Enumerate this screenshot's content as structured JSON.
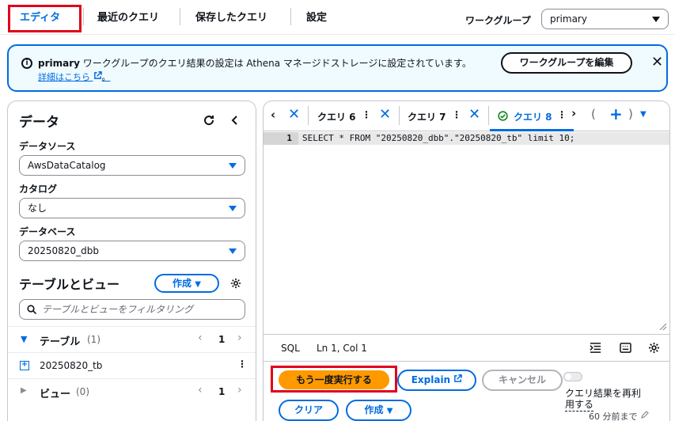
{
  "top_tabs": [
    {
      "label": "エディタ"
    },
    {
      "label": "最近のクエリ"
    },
    {
      "label": "保存したクエリ"
    },
    {
      "label": "設定"
    }
  ],
  "workgroup": {
    "label": "ワークグループ",
    "value": "primary"
  },
  "banner": {
    "workgroup_name": "primary",
    "text": " ワークグループのクエリ結果の設定は Athena マネージドストレージに設定されています。",
    "link": "詳細はこちら",
    "edit_button": "ワークグループを編集"
  },
  "data_panel": {
    "title": "データ",
    "data_source_label": "データソース",
    "data_source_value": "AwsDataCatalog",
    "catalog_label": "カタログ",
    "catalog_value": "なし",
    "database_label": "データベース",
    "database_value": "20250820_dbb",
    "tables_views_title": "テーブルとビュー",
    "create_button": "作成",
    "filter_placeholder": "テーブルとビューをフィルタリング",
    "tables": {
      "label": "テーブル",
      "count": "(1)",
      "page": "1",
      "items": [
        "20250820_tb"
      ]
    },
    "views": {
      "label": "ビュー",
      "count": "(0)",
      "page": "1"
    }
  },
  "editor": {
    "tabs": [
      {
        "label": "クエリ 6"
      },
      {
        "label": "クエリ 7"
      },
      {
        "label": "クエリ 8"
      }
    ],
    "line_number": "1",
    "code": "SELECT * FROM \"20250820_dbb\".\"20250820_tb\" limit 10;",
    "status": {
      "lang": "SQL",
      "position": "Ln 1, Col 1"
    }
  },
  "actions": {
    "run_again": "もう一度実行する",
    "explain": "Explain",
    "cancel": "キャンセル",
    "reuse_label_1": "クエリ結果を再利",
    "reuse_label_2": "用する",
    "reuse_age": "60 分前まで",
    "clear": "クリア",
    "create": "作成"
  },
  "colors": {
    "accent": "#006ce0",
    "primary_button": "#ff9900",
    "highlight_box": "#e0001b"
  }
}
